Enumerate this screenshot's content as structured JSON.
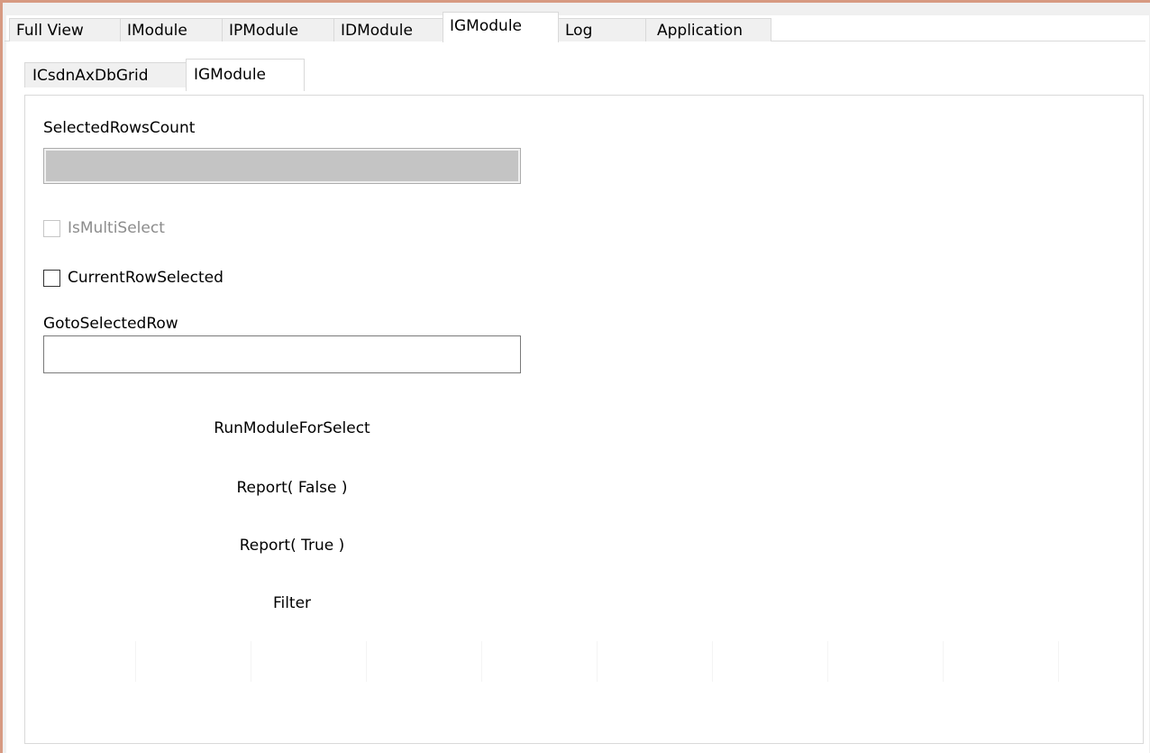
{
  "top_tabs": [
    {
      "label": "Full View",
      "active": false
    },
    {
      "label": "IModule",
      "active": false
    },
    {
      "label": "IPModule",
      "active": false
    },
    {
      "label": "IDModule",
      "active": false
    },
    {
      "label": "IGModule",
      "active": true
    },
    {
      "label": "Log",
      "active": false
    },
    {
      "label": "Application",
      "active": false
    }
  ],
  "sub_tabs": [
    {
      "label": "ICsdnAxDbGrid",
      "active": false
    },
    {
      "label": "IGModule",
      "active": true
    }
  ],
  "panel": {
    "selected_rows_count": {
      "label": "SelectedRowsCount",
      "value": ""
    },
    "is_multi_select": {
      "label": "IsMultiSelect",
      "checked": false,
      "enabled": false
    },
    "current_row_selected": {
      "label": "CurrentRowSelected",
      "checked": false,
      "enabled": true
    },
    "goto_selected_row": {
      "label": "GotoSelectedRow",
      "value": ""
    },
    "buttons": {
      "run_module_for_select": "RunModuleForSelect",
      "report_false": "Report( False )",
      "report_true": "Report( True )",
      "filter": "Filter"
    }
  },
  "colors": {
    "window_border": "#d79a82",
    "tab_border": "#d9d9d9",
    "readonly_field_bg": "#c4c4c4"
  }
}
